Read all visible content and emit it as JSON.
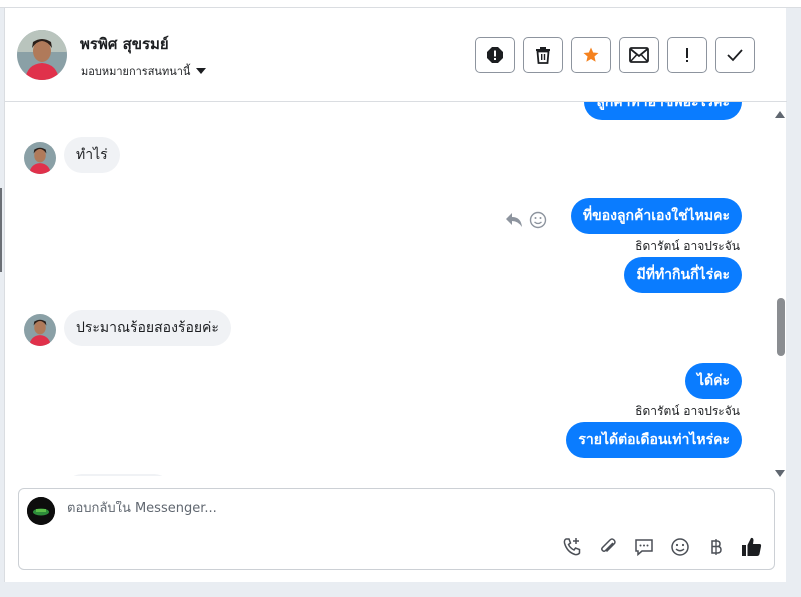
{
  "contact": {
    "name": "พรพิศ สุขรมย์",
    "assign_label": "มอบหมายการสนทนานี้"
  },
  "header_actions": [
    {
      "name": "spam-icon"
    },
    {
      "name": "trash-icon"
    },
    {
      "name": "star-icon",
      "color": "#f5821f"
    },
    {
      "name": "mail-icon"
    },
    {
      "name": "follow-up-icon"
    },
    {
      "name": "done-icon"
    }
  ],
  "messages": {
    "top_partial": "ลูกค้าทำอาชีพอะไรคะ",
    "m1": "ทำไร่",
    "m2": "ที่ของลูกค้าเองใช่ไหมคะ",
    "sender1": "ธิดารัตน์ อาจประจัน",
    "m3": "มีที่ทำกินกี่ไร่คะ",
    "m4": "ประมาณร้อยสองร้อยค่ะ",
    "m5": "ได้ค่ะ",
    "sender2": "ธิดารัตน์ อาจประจัน",
    "m6": "รายได้ต่อเดือนเท่าไหร่คะ"
  },
  "composer": {
    "placeholder": "ตอบกลับใน Messenger..."
  },
  "colors": {
    "outgoing": "#0a7cff",
    "incoming": "#f0f2f5",
    "accent_star": "#f5821f"
  }
}
